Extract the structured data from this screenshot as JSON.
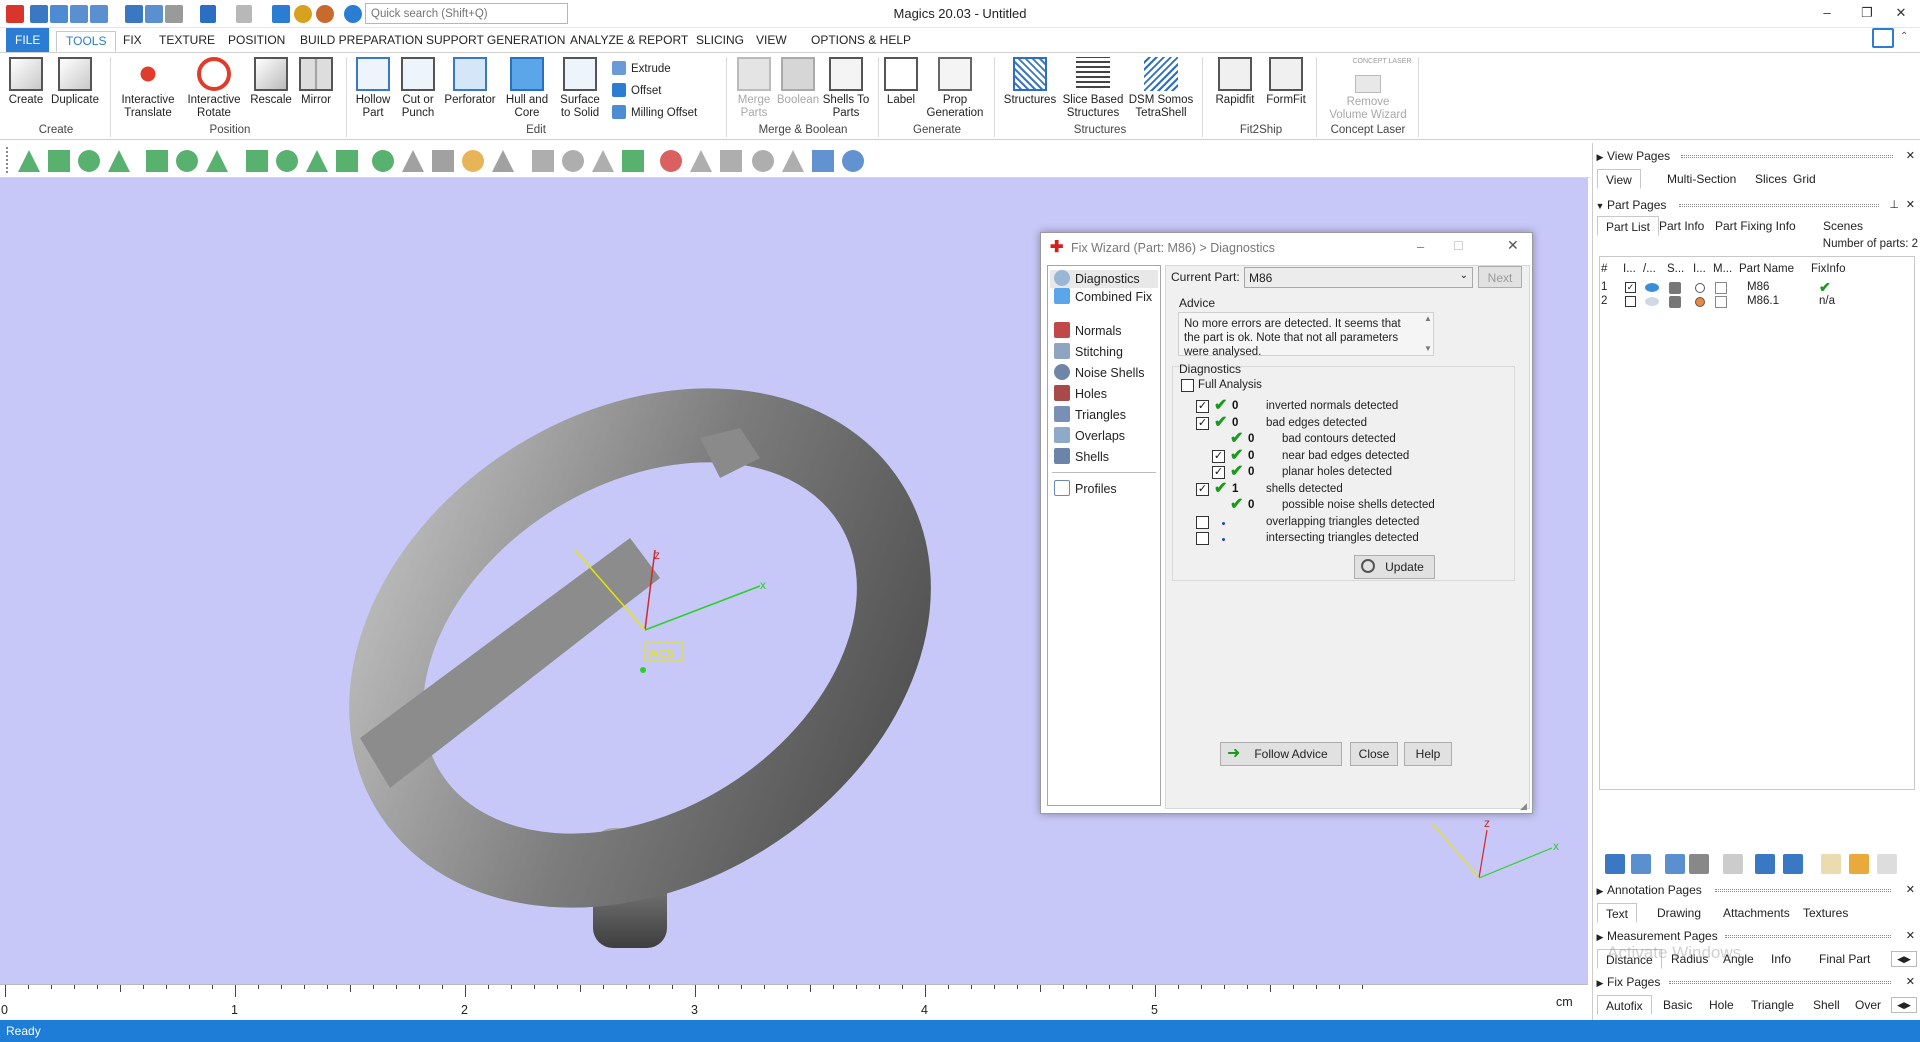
{
  "titlebar": {
    "title": "Magics 20.03 - Untitled",
    "search_placeholder": "Quick search (Shift+Q)",
    "min": "–",
    "restore": "❐",
    "close": "✕"
  },
  "menu": {
    "tabs": [
      "FILE",
      "TOOLS",
      "FIX",
      "TEXTURE",
      "POSITION",
      "BUILD PREPARATION",
      "SUPPORT GENERATION",
      "ANALYZE & REPORT",
      "SLICING",
      "VIEW",
      "OPTIONS & HELP"
    ],
    "active": "TOOLS"
  },
  "ribbon": {
    "create": [
      "Create",
      "Duplicate"
    ],
    "create_group": "Create",
    "position": [
      "Interactive Translate",
      "Interactive Rotate",
      "Rescale",
      "Mirror"
    ],
    "position_group": "Position",
    "edit": [
      "Hollow Part",
      "Cut or Punch",
      "Perforator",
      "Hull and Core",
      "Surface to Solid"
    ],
    "edit_small": [
      "Extrude",
      "Offset",
      "Milling Offset"
    ],
    "edit_group": "Edit",
    "merge": [
      "Merge Parts",
      "Boolean",
      "Shells To Parts"
    ],
    "merge_group": "Merge & Boolean",
    "generate": [
      "Label",
      "Prop Generation"
    ],
    "generate_group": "Generate",
    "structures": [
      "Structures",
      "Slice Based Structures",
      "DSM Somos TetraShell"
    ],
    "structures_group": "Structures",
    "fit2ship": [
      "Rapidfit",
      "FormFit"
    ],
    "fit2ship_group": "Fit2Ship",
    "concept_logo": "CONCEPT LASER",
    "concept": [
      "Remove Volume Wizard"
    ],
    "concept_group": "Concept Laser"
  },
  "viewport": {
    "wcs_label": "WCS",
    "axis_labels": {
      "x": "x",
      "y": "y",
      "z": "z"
    },
    "ruler": {
      "ticks": [
        "0",
        "1",
        "2",
        "3",
        "4",
        "5"
      ],
      "unit": "cm"
    }
  },
  "status": "Ready",
  "dialog": {
    "title": "Fix Wizard (Part: M86) > Diagnostics",
    "nav": [
      "Diagnostics",
      "Combined Fix",
      "Normals",
      "Stitching",
      "Noise Shells",
      "Holes",
      "Triangles",
      "Overlaps",
      "Shells",
      "Profiles"
    ],
    "current_part_label": "Current Part:",
    "current_part": "M86",
    "next": "Next",
    "advice_label": "Advice",
    "advice_text": "No more errors are detected. It seems that the part is ok. Note that not all parameters were analysed.",
    "diagnostics_label": "Diagnostics",
    "full_analysis": "Full Analysis",
    "rows": [
      {
        "count": "0",
        "label": "inverted normals detected"
      },
      {
        "count": "0",
        "label": "bad edges detected"
      },
      {
        "count": "0",
        "label": "bad contours detected"
      },
      {
        "count": "0",
        "label": "near bad edges detected"
      },
      {
        "count": "0",
        "label": "planar holes detected"
      },
      {
        "count": "1",
        "label": "shells detected"
      },
      {
        "count": "0",
        "label": "possible noise shells detected"
      },
      {
        "count": "",
        "label": "overlapping triangles detected"
      },
      {
        "count": "",
        "label": "intersecting triangles detected"
      }
    ],
    "update": "Update",
    "follow_advice": "Follow Advice",
    "close": "Close",
    "help": "Help"
  },
  "panel": {
    "view_pages": "View Pages",
    "view_tabs": [
      "View",
      "Multi-Section",
      "Slices",
      "Grid"
    ],
    "part_pages": "Part Pages",
    "part_tabs": [
      "Part List",
      "Part Info",
      "Part Fixing Info",
      "Scenes"
    ],
    "num_parts": "Number of parts: 2",
    "columns": [
      "#",
      "I...",
      "/...",
      "S...",
      "I...",
      "M...",
      "Part Name",
      "FixInfo"
    ],
    "parts": [
      {
        "num": "1",
        "name": "M86",
        "fix": "✔"
      },
      {
        "num": "2",
        "name": "M86.1",
        "fix": "n/a"
      }
    ],
    "annotation_pages": "Annotation Pages",
    "annotation_tabs": [
      "Text",
      "Drawing",
      "Attachments",
      "Textures"
    ],
    "measurement_pages": "Measurement Pages",
    "measurement_tabs": [
      "Distance",
      "Radius",
      "Angle",
      "Info",
      "Final Part"
    ],
    "fix_pages": "Fix Pages",
    "fix_tabs": [
      "Autofix",
      "Basic",
      "Hole",
      "Triangle",
      "Shell",
      "Over"
    ],
    "watermark": "Activate Windows"
  },
  "colors": {
    "accent": "#2b7cd3",
    "viewport": "#c8c8f8",
    "status": "#1e7dd6",
    "check": "#1a9a1a"
  }
}
